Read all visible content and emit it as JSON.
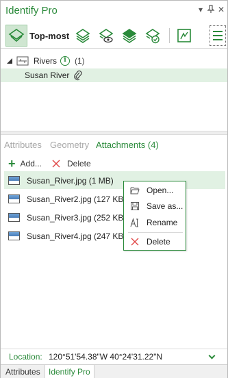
{
  "window": {
    "title": "Identify Pro",
    "colors": {
      "accent": "#2a8a3a",
      "selection": "#e1f1e3"
    }
  },
  "toolbar": {
    "topmost_label": "Top-most",
    "buttons": [
      {
        "icon": "layers-topmost-icon",
        "active": true
      },
      {
        "icon": "layers-all-icon"
      },
      {
        "icon": "layers-visible-icon"
      },
      {
        "icon": "layers-selectable-icon"
      },
      {
        "icon": "layers-selected-icon"
      },
      {
        "icon": "map-frame-icon"
      },
      {
        "icon": "menu-icon"
      }
    ]
  },
  "tree": {
    "layer": {
      "name": "Rivers",
      "count": "(1)"
    },
    "feature": {
      "name": "Susan River"
    }
  },
  "tabs": [
    "Attributes",
    "Geometry",
    "Attachments (4)"
  ],
  "actions": {
    "add": "Add...",
    "delete": "Delete"
  },
  "files": [
    {
      "name": "Susan_River.jpg (1 MB)",
      "selected": true
    },
    {
      "name": "Susan_River2.jpg (127 KB)"
    },
    {
      "name": "Susan_River3.jpg (252 KB)"
    },
    {
      "name": "Susan_River4.jpg (247 KB)"
    }
  ],
  "context_menu": {
    "items": [
      {
        "label": "Open...",
        "icon": "folder-open-icon"
      },
      {
        "label": "Save as...",
        "icon": "save-icon"
      },
      {
        "label": "Rename",
        "icon": "rename-icon"
      },
      {
        "label": "Delete",
        "icon": "delete-icon"
      }
    ]
  },
  "location": {
    "label": "Location:",
    "value": "120°51'54.38\"W 40°24'31.22\"N"
  },
  "bottom_tabs": [
    "Attributes",
    "Identify Pro"
  ]
}
